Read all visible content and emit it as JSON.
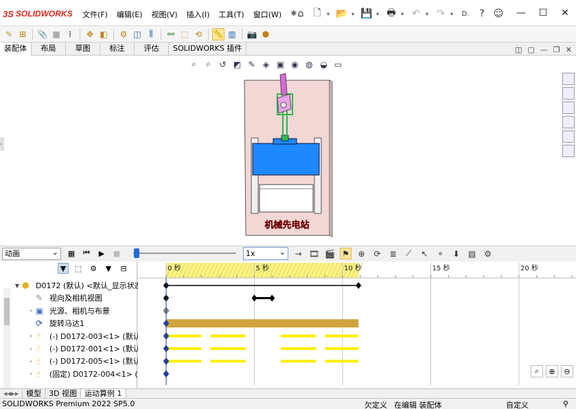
{
  "app": {
    "logo_text": "SOLIDWORKS",
    "logo_prefix": "3S"
  },
  "menu": [
    "文件(F)",
    "编辑(E)",
    "视图(V)",
    "插入(I)",
    "工具(T)",
    "窗口(W)"
  ],
  "quick_access": {
    "icons": [
      "home-icon",
      "new-file-icon",
      "open-file-icon",
      "save-icon",
      "print-icon",
      "undo-icon",
      "redo-icon",
      "select-icon",
      "help-icon",
      "user-icon",
      "search-icon"
    ],
    "search_text": "D."
  },
  "window_controls": [
    "minimize",
    "maximize",
    "close"
  ],
  "command_tabs": [
    "装配体",
    "布局",
    "草图",
    "标注",
    "评估",
    "SOLIDWORKS 插件"
  ],
  "active_command_tab": "装配体",
  "model": {
    "watermark": "机械先电站",
    "colors": {
      "plate": "#f3d7d5",
      "gate": "#1e88ff",
      "frame": "#e8e8e8",
      "linkage": "#2db84d",
      "handle": "#d36bd6"
    }
  },
  "motion_toolbar": {
    "study_type": "动画",
    "play_speed": "1x",
    "slider_position": 0.02
  },
  "timeline": {
    "ticks": [
      {
        "label": "0 秒",
        "sec": 0
      },
      {
        "label": "5 秒",
        "sec": 5
      },
      {
        "label": "10 秒",
        "sec": 10
      },
      {
        "label": "15 秒",
        "sec": 15
      },
      {
        "label": "20 秒",
        "sec": 20
      }
    ],
    "active_range_sec": [
      0,
      10.9
    ]
  },
  "tree": {
    "rows": [
      {
        "label": "D0172 (默认) <默认_显示状态",
        "icon": "assembly-icon",
        "expander": "▼",
        "indent": 0
      },
      {
        "label": "视向及相机视图",
        "icon": "camera-view-icon",
        "expander": "",
        "indent": 1
      },
      {
        "label": "光源、相机与布景",
        "icon": "lights-icon",
        "expander": "›",
        "indent": 1
      },
      {
        "label": "旋转马达1",
        "icon": "motor-icon",
        "expander": "",
        "indent": 1
      },
      {
        "label": "(-) D0172-003<1> (默认)",
        "icon": "part-icon",
        "expander": "›",
        "indent": 1
      },
      {
        "label": "(-) D0172-001<1> (默认)",
        "icon": "part-icon",
        "expander": "›",
        "indent": 1
      },
      {
        "label": "(-) D0172-005<1> (默认)",
        "icon": "part-icon",
        "expander": "›",
        "indent": 1
      },
      {
        "label": "(固定) D0172-004<1> (默",
        "icon": "part-icon",
        "expander": "›",
        "indent": 1
      }
    ]
  },
  "bottom_tabs": [
    "模型",
    "3D 视图",
    "运动算例 1"
  ],
  "active_bottom_tab": "运动算例 1",
  "status": {
    "product": "SOLIDWORKS Premium 2022 SP5.0",
    "definition": "欠定义",
    "mode": "在编辑 装配体",
    "custom": "自定义"
  }
}
